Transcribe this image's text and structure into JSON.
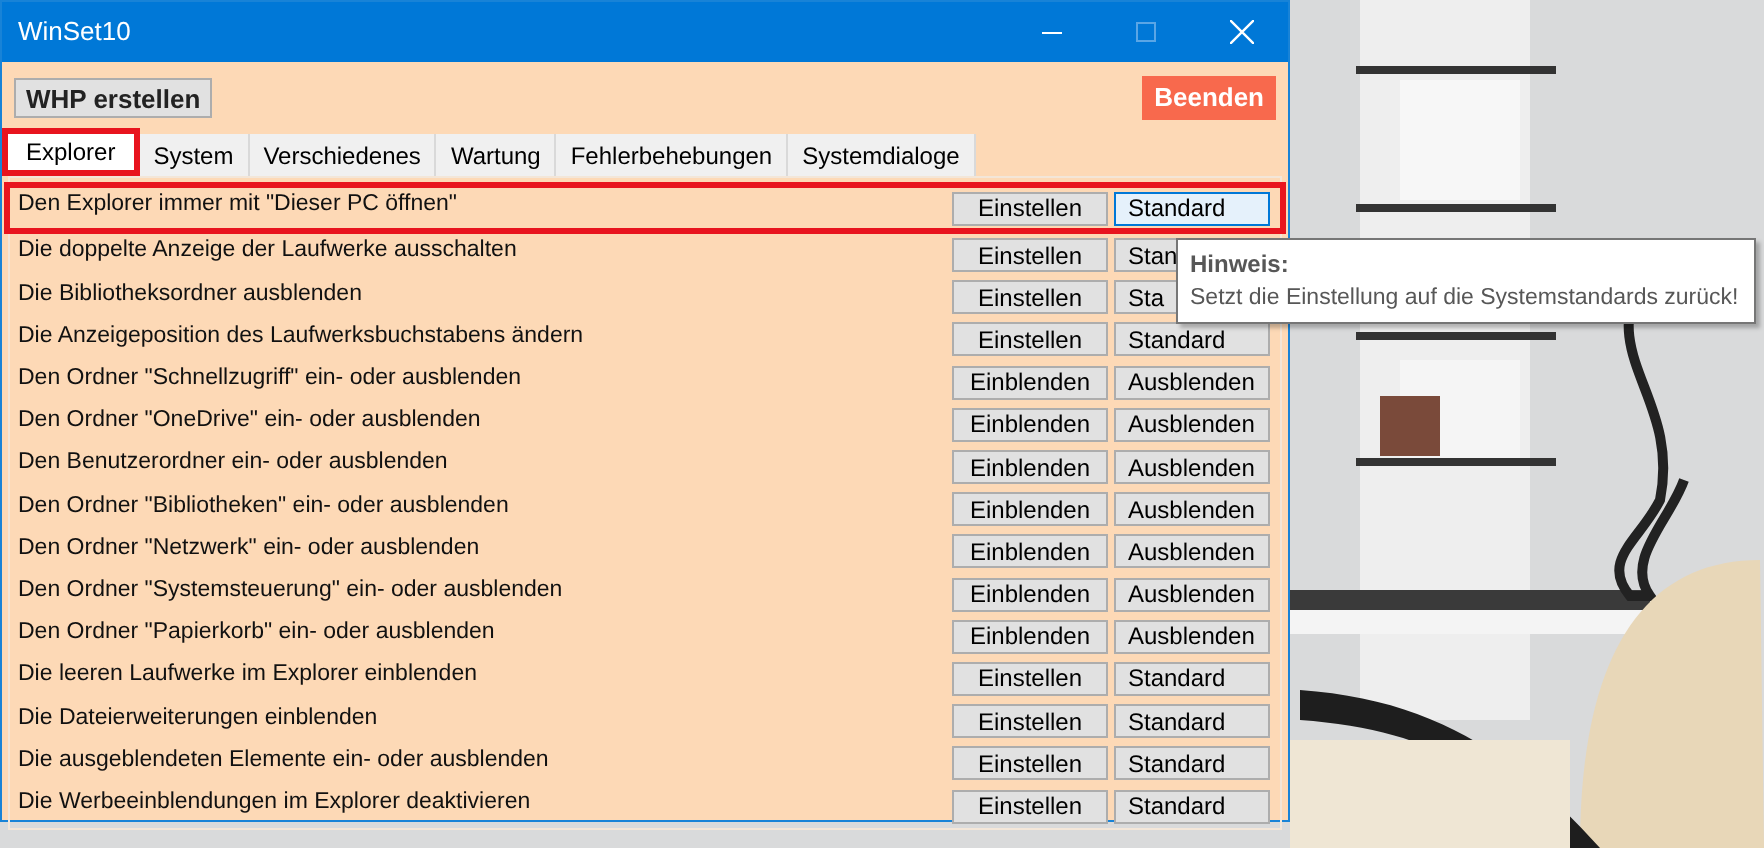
{
  "window": {
    "title": "WinSet10"
  },
  "toolbar": {
    "create_button": "WHP erstellen",
    "exit_button": "Beenden"
  },
  "tabs": [
    {
      "label": "Explorer",
      "selected": true,
      "highlighted": true
    },
    {
      "label": "System",
      "selected": false,
      "highlighted": false
    },
    {
      "label": "Verschiedenes",
      "selected": false,
      "highlighted": false
    },
    {
      "label": "Wartung",
      "selected": false,
      "highlighted": false
    },
    {
      "label": "Fehlerbehebungen",
      "selected": false,
      "highlighted": false
    },
    {
      "label": "Systemdialoge",
      "selected": false,
      "highlighted": false
    }
  ],
  "rows": [
    {
      "label": "Den Explorer immer mit \"Dieser PC öffnen\"",
      "buttons": [
        {
          "label": "Einstellen",
          "hovered": false
        },
        {
          "label": "Standard",
          "hovered": true
        }
      ],
      "highlighted": true
    },
    {
      "label": "Die doppelte Anzeige der Laufwerke ausschalten",
      "buttons": [
        {
          "label": "Einstellen",
          "hovered": false
        },
        {
          "label": "Stan",
          "hovered": false
        }
      ],
      "highlighted": false
    },
    {
      "label": "Die Bibliotheksordner ausblenden",
      "buttons": [
        {
          "label": "Einstellen",
          "hovered": false
        },
        {
          "label": "Sta",
          "hovered": false
        }
      ],
      "highlighted": false
    },
    {
      "label": "Die Anzeigeposition des Laufwerksbuchstabens ändern",
      "buttons": [
        {
          "label": "Einstellen",
          "hovered": false
        },
        {
          "label": "Standard",
          "hovered": false
        }
      ],
      "highlighted": false
    },
    {
      "label": "Den Ordner \"Schnellzugriff\" ein- oder ausblenden",
      "buttons": [
        {
          "label": "Einblenden",
          "hovered": false
        },
        {
          "label": "Ausblenden",
          "hovered": false
        }
      ],
      "highlighted": false
    },
    {
      "label": "Den Ordner \"OneDrive\" ein- oder ausblenden",
      "buttons": [
        {
          "label": "Einblenden",
          "hovered": false
        },
        {
          "label": "Ausblenden",
          "hovered": false
        }
      ],
      "highlighted": false
    },
    {
      "label": "Den Benutzerordner ein- oder ausblenden",
      "buttons": [
        {
          "label": "Einblenden",
          "hovered": false
        },
        {
          "label": "Ausblenden",
          "hovered": false
        }
      ],
      "highlighted": false
    },
    {
      "label": "Den Ordner \"Bibliotheken\" ein- oder ausblenden",
      "buttons": [
        {
          "label": "Einblenden",
          "hovered": false
        },
        {
          "label": "Ausblenden",
          "hovered": false
        }
      ],
      "highlighted": false
    },
    {
      "label": "Den Ordner \"Netzwerk\" ein- oder ausblenden",
      "buttons": [
        {
          "label": "Einblenden",
          "hovered": false
        },
        {
          "label": "Ausblenden",
          "hovered": false
        }
      ],
      "highlighted": false
    },
    {
      "label": "Den Ordner \"Systemsteuerung\" ein- oder ausblenden",
      "buttons": [
        {
          "label": "Einblenden",
          "hovered": false
        },
        {
          "label": "Ausblenden",
          "hovered": false
        }
      ],
      "highlighted": false
    },
    {
      "label": "Den Ordner \"Papierkorb\" ein- oder ausblenden",
      "buttons": [
        {
          "label": "Einblenden",
          "hovered": false
        },
        {
          "label": "Ausblenden",
          "hovered": false
        }
      ],
      "highlighted": false
    },
    {
      "label": "Die leeren Laufwerke im Explorer einblenden",
      "buttons": [
        {
          "label": "Einstellen",
          "hovered": false
        },
        {
          "label": "Standard",
          "hovered": false
        }
      ],
      "highlighted": false
    },
    {
      "label": "Die Dateierweiterungen einblenden",
      "buttons": [
        {
          "label": "Einstellen",
          "hovered": false
        },
        {
          "label": "Standard",
          "hovered": false
        }
      ],
      "highlighted": false
    },
    {
      "label": "Die ausgeblendeten Elemente ein- oder ausblenden",
      "buttons": [
        {
          "label": "Einstellen",
          "hovered": false
        },
        {
          "label": "Standard",
          "hovered": false
        }
      ],
      "highlighted": false
    },
    {
      "label": "Die Werbeeinblendungen im Explorer deaktivieren",
      "buttons": [
        {
          "label": "Einstellen",
          "hovered": false
        },
        {
          "label": "Standard",
          "hovered": false
        }
      ],
      "highlighted": false
    }
  ],
  "tooltip": {
    "title": "Hinweis:",
    "text": "Setzt die Einstellung auf die Systemstandards zurück!"
  }
}
